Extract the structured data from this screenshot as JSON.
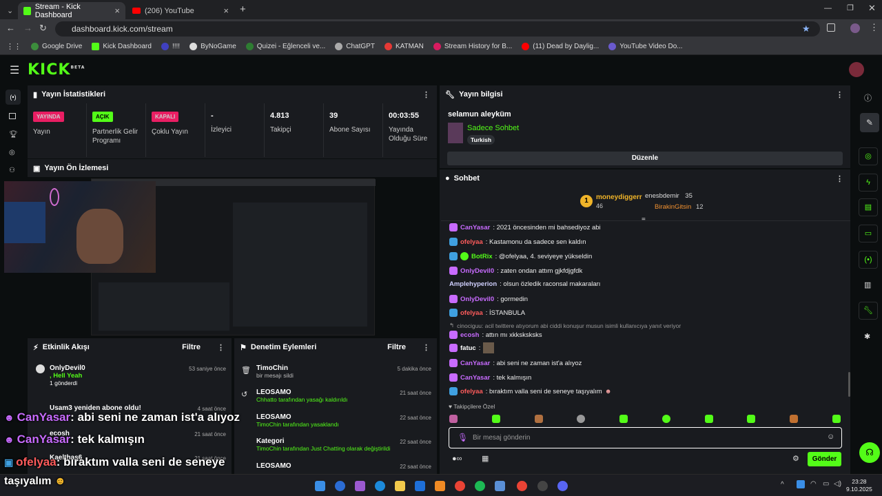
{
  "browser": {
    "tabs": [
      {
        "title": "Stream - Kick Dashboard"
      },
      {
        "title": "(206) YouTube"
      }
    ],
    "url": "dashboard.kick.com/stream",
    "bookmarks": [
      "Google Drive",
      "Kick Dashboard",
      "!!!!",
      "ByNoGame",
      "Quizei - Eğlenceli ve...",
      "ChatGPT",
      "KATMAN",
      "Stream History for B...",
      "(11) Dead by Daylig...",
      "YouTube Video Do..."
    ]
  },
  "kick": {
    "logo": "KICK",
    "beta": "BETA"
  },
  "stats": {
    "title": "Yayın İstatistikleri",
    "items": [
      {
        "badge": "YAYINDA",
        "label": "Yayın"
      },
      {
        "badge": "AÇIK",
        "label": "Partnerlik Gelir Programı"
      },
      {
        "badge": "KAPALI",
        "label": "Çoklu Yayın"
      },
      {
        "value": "-",
        "label": "İzleyici"
      },
      {
        "value": "4.813",
        "label": "Takipçi"
      },
      {
        "value": "39",
        "label": "Abone Sayısı"
      },
      {
        "value": "00:03:55",
        "label": "Yayında Olduğu Süre"
      }
    ]
  },
  "preview": {
    "title": "Yayın Ön İzlemesi"
  },
  "activity": {
    "title": "Etkinlik Akışı",
    "filter": "Filtre",
    "items": [
      {
        "user": "OnlyDevil0",
        "sub": ", Hell Yeah",
        "extra": "1 gönderdi",
        "time": "53 saniye önce"
      },
      {
        "user": "Usam3 yeniden abone oldu!",
        "time": "4 saat önce"
      },
      {
        "user": "ecosh",
        "time": "21 saat önce"
      },
      {
        "user": "Kaelthas6",
        "time": "21 saat önce"
      }
    ]
  },
  "moderation": {
    "title": "Denetim Eylemleri",
    "filter": "Filtre",
    "items": [
      {
        "user": "TimoChin",
        "desc": "bir mesajı sildi",
        "time": "5 dakika önce"
      },
      {
        "user": "LEOSAMO",
        "desc": "Chhatto tarafından yasağı kaldırıldı",
        "time": "21 saat önce"
      },
      {
        "user": "LEOSAMO",
        "desc": "TimoChin tarafından yasaklandı",
        "time": "22 saat önce"
      },
      {
        "user": "Kategori",
        "desc": "TimoChin tarafından Just Chatting olarak değiştirildi",
        "time": "22 saat önce"
      },
      {
        "user": "LEOSAMO",
        "desc": "",
        "time": "22 saat önce"
      }
    ]
  },
  "info": {
    "title": "Yayın bilgisi",
    "stream_title": "selamun aleyküm",
    "category": "Sadece Sohbet",
    "language": "Turkish",
    "edit": "Düzenle"
  },
  "chat": {
    "title": "Sohbet",
    "top": [
      {
        "user": "moneydiggerr",
        "count": "46"
      },
      {
        "user": "enesbdemir",
        "count": "35"
      },
      {
        "user": "BirakinGitsin",
        "count": "12"
      }
    ],
    "messages": [
      {
        "user": "CanYasar",
        "text": ": 2021 öncesinden mi bahsediyoz abi",
        "color": "#c86bff"
      },
      {
        "user": "ofelyaa",
        "text": ": Kastamonu da sadece sen kaldın",
        "color": "#ff5c5c"
      },
      {
        "user": "BotRix",
        "text": ": @ofelyaa, 4. seviyeye yükseldin",
        "color": "#53fc18"
      },
      {
        "user": "OnlyDevil0",
        "text": ": zaten ondan attım gjkfdjgfdk",
        "color": "#c86bff"
      },
      {
        "user": "Amplehyperion",
        "text": ": olsun özledik raconsal makaraları",
        "color": "#d0d0ff"
      },
      {
        "user": "OnlyDevil0",
        "text": ": gormedin",
        "color": "#c86bff"
      },
      {
        "user": "ofelyaa",
        "text": ": İSTANBULA",
        "color": "#ff5c5c"
      },
      {
        "user": "",
        "text": "cinociguu: acil twittere atıyorum abi ciddi konuşur musun isimli kullanıcıya yanıt veriyor",
        "color": "#999"
      },
      {
        "user": "ecosh",
        "text": ": attın mı xkksksksks",
        "color": "#c86bff"
      },
      {
        "user": "fatuc",
        "text": ":",
        "color": "#ffffff"
      },
      {
        "user": "CanYasar",
        "text": ": abi seni ne zaman ist'a alıyoz",
        "color": "#c86bff"
      },
      {
        "user": "CanYasar",
        "text": ": tek kalmışın",
        "color": "#c86bff"
      },
      {
        "user": "ofelyaa",
        "text": ": bıraktım valla seni de seneye taşıyalım",
        "color": "#ff5c5c"
      }
    ],
    "emote_tab": "Takipçilere Özel",
    "placeholder": "Bir mesaj gönderin",
    "send": "Gönder"
  },
  "overlay": {
    "lines": [
      {
        "user": "CanYasar",
        "text": ": abi seni ne zaman ist'a alıyoz"
      },
      {
        "user": "CanYasar",
        "text": ": tek kalmışın"
      },
      {
        "user": "ofelyaa",
        "text": ": bıraktım valla seni de seneye"
      }
    ],
    "wrap": "taşıyalım"
  },
  "taskbar": {
    "time": "23:28",
    "date": "9.10.2025"
  },
  "colors": {
    "kick": "#53fc18",
    "live": "#e91e63",
    "panel": "#191b1f"
  }
}
